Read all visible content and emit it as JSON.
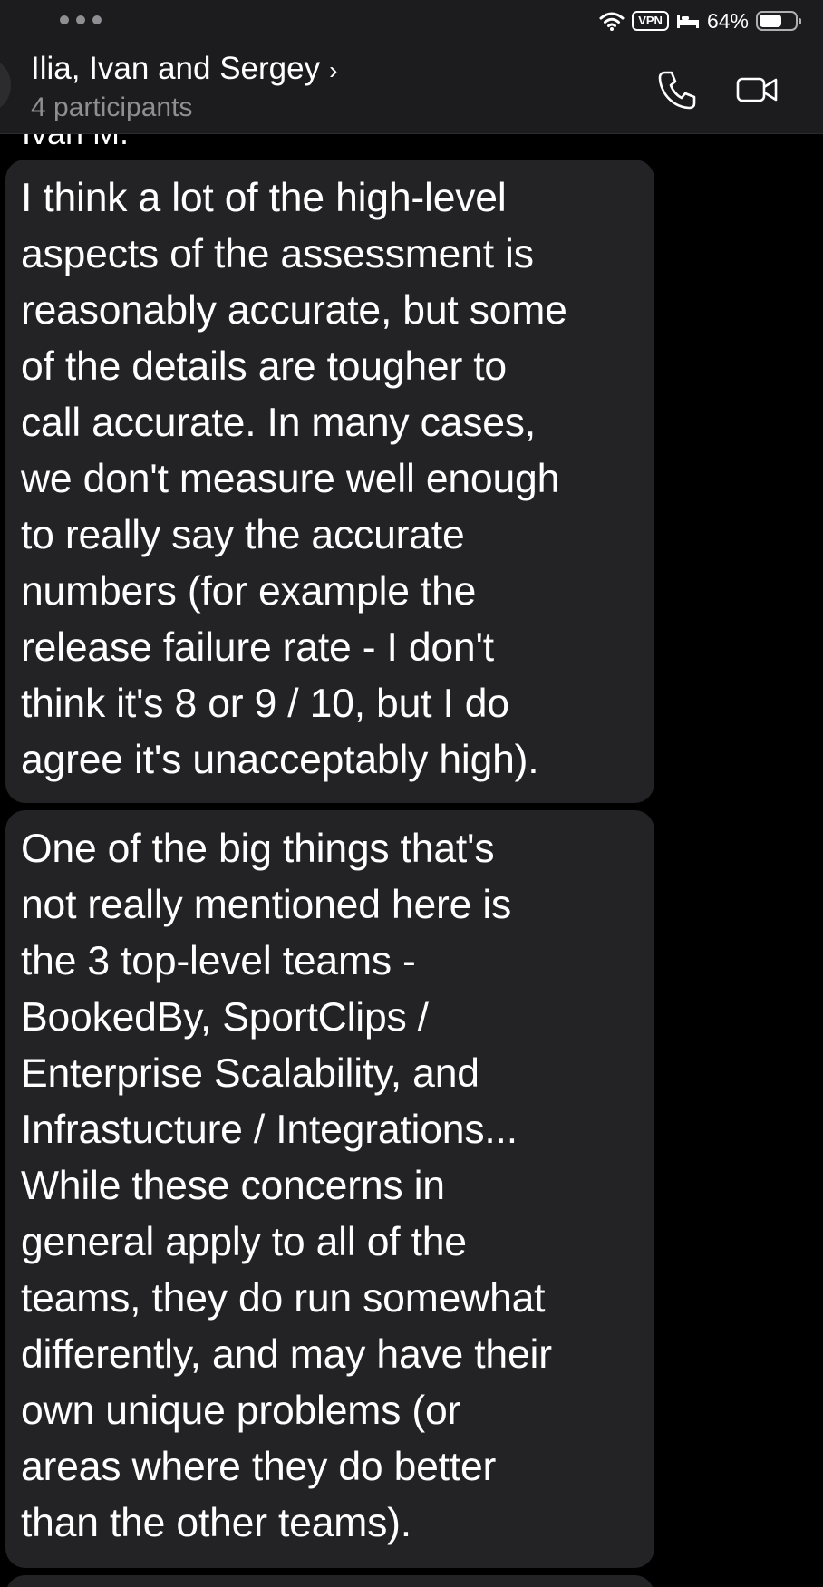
{
  "status_bar": {
    "battery_text": "64%",
    "battery_level": 0.64,
    "vpn_label": "VPN"
  },
  "header": {
    "title": "Ilia, Ivan and Sergey",
    "subtitle": "4 participants"
  },
  "messages": {
    "sender": "Ivan M.",
    "items": [
      {
        "lines": [
          "I think a lot of the high-level",
          "aspects of the assessment is",
          "reasonably accurate, but some",
          "of the details are tougher to",
          "call accurate. In many cases,",
          "we don't measure well enough",
          "to really say the accurate",
          "numbers (for example the",
          "release failure rate - I don't",
          "think it's 8 or 9 / 10, but I do",
          "agree it's unacceptably high)."
        ]
      },
      {
        "lines": [
          "One of the big things that's",
          "not really mentioned here is",
          "the 3 top-level teams -",
          "BookedBy, SportClips /",
          "Enterprise Scalability, and",
          "Infrastucture / Integrations...",
          "While these concerns in",
          "general apply to all of the",
          "teams, they do run somewhat",
          "differently, and may have their",
          "own unique problems (or",
          "areas where they do better",
          "than the other teams)."
        ]
      }
    ]
  }
}
